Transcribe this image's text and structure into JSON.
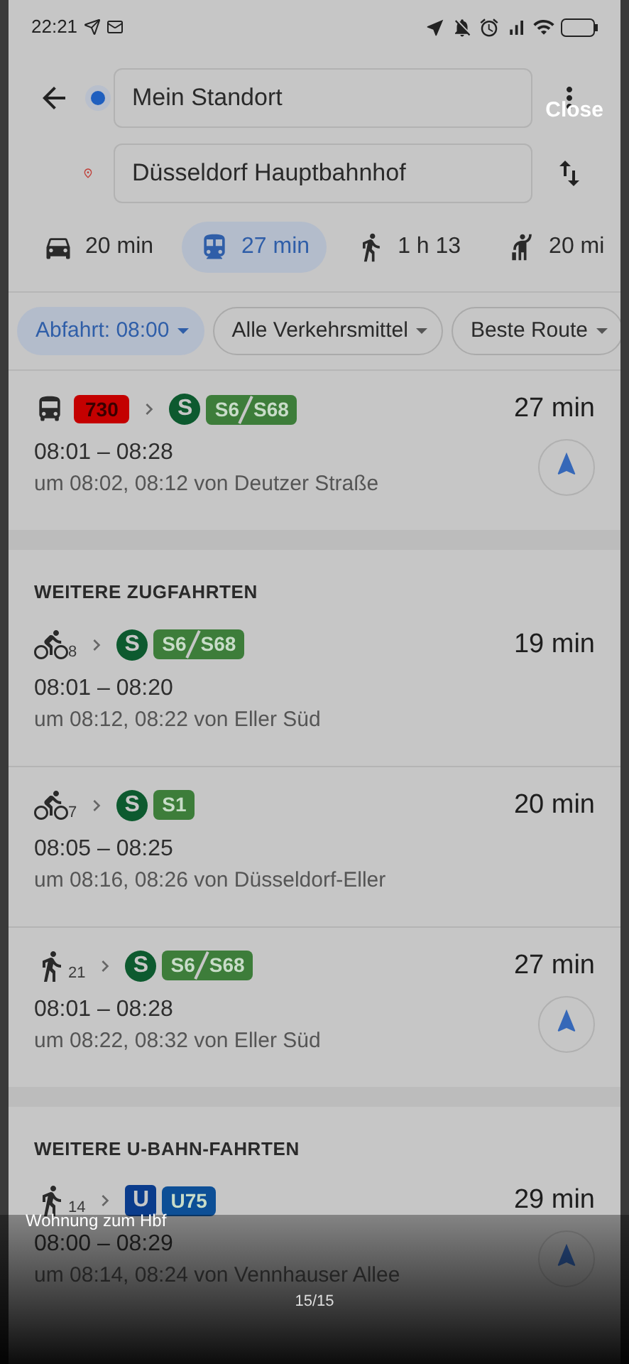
{
  "status_bar": {
    "time": "22:21"
  },
  "route": {
    "origin": "Mein Standort",
    "destination": "Düsseldorf Hauptbahnhof"
  },
  "modes": [
    {
      "kind": "car",
      "label": "20 min",
      "selected": false
    },
    {
      "kind": "transit",
      "label": "27 min",
      "selected": true
    },
    {
      "kind": "walk",
      "label": "1 h 13",
      "selected": false
    },
    {
      "kind": "ride",
      "label": "20 mi",
      "selected": false
    }
  ],
  "filters": [
    {
      "label": "Abfahrt: 08:00",
      "selected": true
    },
    {
      "label": "Alle Verkehrsmittel",
      "selected": false
    },
    {
      "label": "Beste Route",
      "selected": false
    }
  ],
  "sections": [
    {
      "routes": [
        {
          "legs": [
            {
              "kind": "bus",
              "lines": [
                "730"
              ],
              "color": "#c40000"
            },
            {
              "kind": "sbahn",
              "symbol": "S",
              "lines": [
                "S6",
                "S68"
              ],
              "color": "#3d7d3a"
            }
          ],
          "duration": "27 min",
          "times": "08:01 – 08:28",
          "detail": "um 08:02, 08:12 von Deutzer Straße",
          "navigate": true
        }
      ]
    },
    {
      "title": "WEITERE ZUGFAHRTEN",
      "routes": [
        {
          "legs": [
            {
              "kind": "bike",
              "minutes": "8"
            },
            {
              "kind": "sbahn",
              "symbol": "S",
              "lines": [
                "S6",
                "S68"
              ],
              "color": "#3d7d3a"
            }
          ],
          "duration": "19 min",
          "times": "08:01 – 08:20",
          "detail": "um 08:12, 08:22 von Eller Süd",
          "navigate": false
        },
        {
          "legs": [
            {
              "kind": "bike",
              "minutes": "7"
            },
            {
              "kind": "sbahn",
              "symbol": "S",
              "lines": [
                "S1"
              ],
              "color": "#3d7d3a"
            }
          ],
          "duration": "20 min",
          "times": "08:05 – 08:25",
          "detail": "um 08:16, 08:26 von Düsseldorf-Eller",
          "navigate": false
        },
        {
          "legs": [
            {
              "kind": "walk",
              "minutes": "21"
            },
            {
              "kind": "sbahn",
              "symbol": "S",
              "lines": [
                "S6",
                "S68"
              ],
              "color": "#3d7d3a"
            }
          ],
          "duration": "27 min",
          "times": "08:01 – 08:28",
          "detail": "um 08:22, 08:32 von Eller Süd",
          "navigate": true
        }
      ]
    },
    {
      "title": "WEITERE U-BAHN-FAHRTEN",
      "routes": [
        {
          "legs": [
            {
              "kind": "walk",
              "minutes": "14"
            },
            {
              "kind": "ubahn",
              "symbol": "U",
              "lines": [
                "U75"
              ],
              "color": "#0d4f96"
            }
          ],
          "duration": "29 min",
          "times": "08:00 – 08:29",
          "detail": "um 08:14, 08:24 von Vennhauser Allee",
          "navigate": true
        }
      ]
    }
  ],
  "viewer": {
    "close": "Close",
    "caption": "Wohnung zum Hbf",
    "counter": "15/15"
  }
}
